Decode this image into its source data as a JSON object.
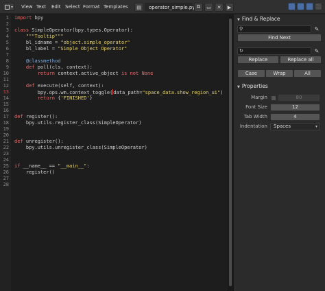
{
  "header": {
    "menus": [
      "View",
      "Text",
      "Edit",
      "Select",
      "Format",
      "Templates"
    ],
    "filename": "operator_simple.py",
    "icons": [
      "text-editor-icon",
      "new-file-icon",
      "open-file-icon",
      "close-icon",
      "run-script-icon"
    ]
  },
  "editor": {
    "line_numbers": [
      "1",
      "2",
      "3",
      "4",
      "5",
      "6",
      "7",
      "8",
      "9",
      "10",
      "11",
      "12",
      "13",
      "14",
      "15",
      "16",
      "17",
      "18",
      "19",
      "20",
      "21",
      "22",
      "23",
      "24",
      "25",
      "26",
      "27",
      "28"
    ],
    "current_line": "13",
    "lines": [
      [
        {
          "t": "import",
          "c": "kw"
        },
        {
          "t": " bpy",
          "c": "sp"
        }
      ],
      [],
      [
        {
          "t": "class",
          "c": "kw"
        },
        {
          "t": " SimpleOperator(bpy.types.Operator):",
          "c": "sp"
        }
      ],
      [
        {
          "t": "    \"\"\"Tooltip\"\"\"",
          "c": "st"
        }
      ],
      [
        {
          "t": "    bl_idname = ",
          "c": "sp"
        },
        {
          "t": "\"object.simple_operator\"",
          "c": "st"
        }
      ],
      [
        {
          "t": "    bl_label = ",
          "c": "sp"
        },
        {
          "t": "\"Simple Object Operator\"",
          "c": "st"
        }
      ],
      [],
      [
        {
          "t": "    @classmethod",
          "c": "dc"
        }
      ],
      [
        {
          "t": "    ",
          "c": "sp"
        },
        {
          "t": "def",
          "c": "kw"
        },
        {
          "t": " poll(cls, context):",
          "c": "sp"
        }
      ],
      [
        {
          "t": "        ",
          "c": "sp"
        },
        {
          "t": "return",
          "c": "kw"
        },
        {
          "t": " context.active_object ",
          "c": "sp"
        },
        {
          "t": "is not",
          "c": "kw"
        },
        {
          "t": " ",
          "c": "sp"
        },
        {
          "t": "None",
          "c": "kw"
        }
      ],
      [],
      [
        {
          "t": "    ",
          "c": "sp"
        },
        {
          "t": "def",
          "c": "kw"
        },
        {
          "t": " execute(self, context):",
          "c": "sp"
        }
      ],
      [
        {
          "t": "        bpy.ops.wm.context_toggle(",
          "c": "sp"
        },
        {
          "t": "|",
          "c": "cursor"
        },
        {
          "t": "data_path=",
          "c": "sp"
        },
        {
          "t": "\"space_data.show_region_ui\"",
          "c": "st"
        },
        {
          "t": ")",
          "c": "sp"
        }
      ],
      [
        {
          "t": "        ",
          "c": "sp"
        },
        {
          "t": "return",
          "c": "kw"
        },
        {
          "t": " {",
          "c": "sp"
        },
        {
          "t": "'FINISHED'",
          "c": "st"
        },
        {
          "t": "}",
          "c": "sp"
        }
      ],
      [],
      [],
      [
        {
          "t": "def",
          "c": "kw"
        },
        {
          "t": " register():",
          "c": "sp"
        }
      ],
      [
        {
          "t": "    bpy.utils.register_class(SimpleOperator)",
          "c": "sp"
        }
      ],
      [],
      [],
      [
        {
          "t": "def",
          "c": "kw"
        },
        {
          "t": " unregister():",
          "c": "sp"
        }
      ],
      [
        {
          "t": "    bpy.utils.unregister_class(SimpleOperator)",
          "c": "sp"
        }
      ],
      [],
      [],
      [
        {
          "t": "if",
          "c": "kw"
        },
        {
          "t": " __name__ == ",
          "c": "sp"
        },
        {
          "t": "\"__main__\"",
          "c": "st"
        },
        {
          "t": ":",
          "c": "sp"
        }
      ],
      [
        {
          "t": "    register()",
          "c": "sp"
        }
      ],
      [],
      []
    ]
  },
  "find_replace": {
    "title": "Find & Replace",
    "find_value": "",
    "find_next_label": "Find Next",
    "replace_value": "",
    "replace_label": "Replace",
    "replace_all_label": "Replace all",
    "case_label": "Case",
    "wrap_label": "Wrap",
    "all_label": "All"
  },
  "properties": {
    "title": "Properties",
    "margin_label": "Margin",
    "margin_value": "80",
    "font_size_label": "Font Size",
    "font_size_value": "12",
    "tab_width_label": "Tab Width",
    "tab_width_value": "4",
    "indentation_label": "Indentation",
    "indentation_value": "Spaces"
  },
  "colors": {
    "keyword": "#e46f6f",
    "string": "#e9d36a",
    "decorator": "#7db0ea",
    "accent": "#4a6ea3"
  }
}
